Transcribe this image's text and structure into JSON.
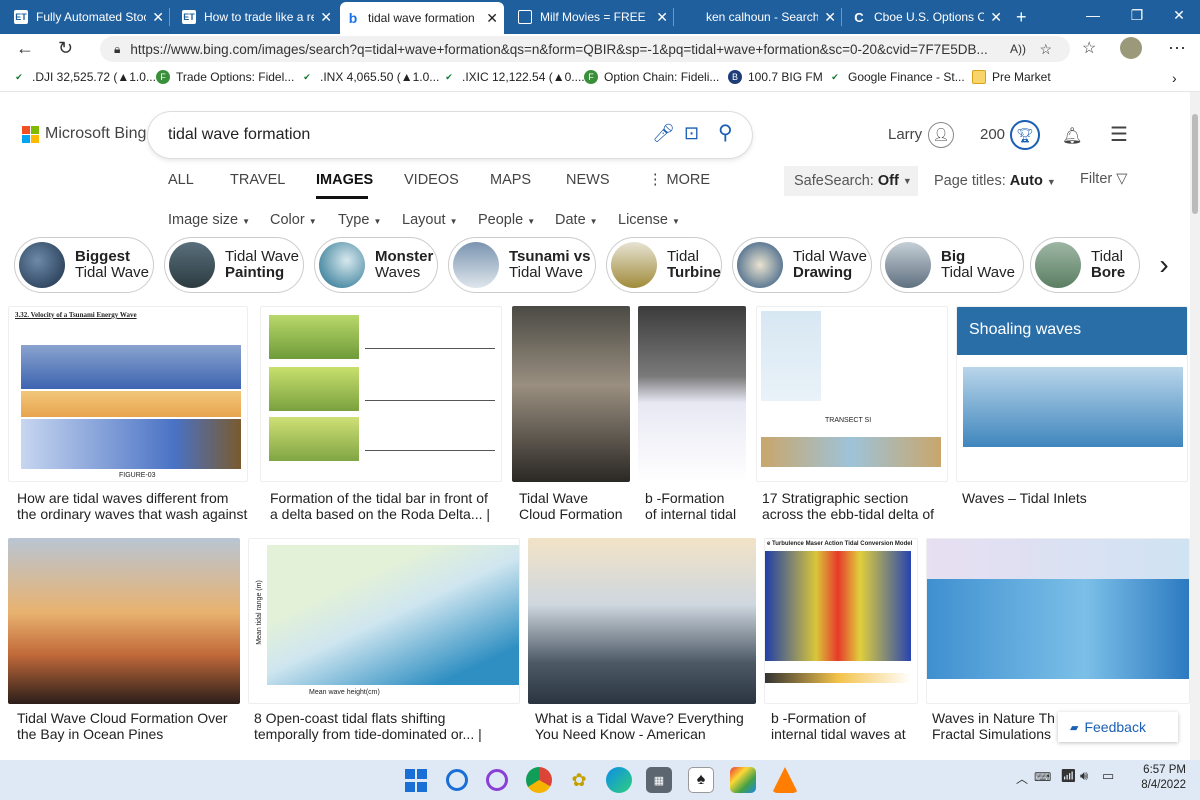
{
  "browser": {
    "tabs": [
      {
        "title": "Fully Automated Stoc",
        "icon": "ET"
      },
      {
        "title": "How to trade like a re",
        "icon": "ET"
      },
      {
        "title": "tidal wave formation",
        "icon": "b"
      },
      {
        "title": "Milf Movies = FREE M",
        "icon": "doc"
      },
      {
        "title": "ken calhoun - Search",
        "icon": ""
      },
      {
        "title": "Cboe U.S. Options Cu",
        "icon": "C"
      }
    ],
    "url": "https://www.bing.com/images/search?q=tidal+wave+formation&qs=n&form=QBIR&sp=-1&pq=tidal+wave+formation&sc=0-20&cvid=7F7E5DB...",
    "favorites": [
      ".DJI 32,525.72 (▲1.0...",
      "Trade Options: Fidel...",
      ".INX 4,065.50 (▲1.0...",
      ".IXIC 12,122.54 (▲0....",
      "Option Chain: Fideli...",
      "100.7 BIG FM",
      "Google Finance - St...",
      "Pre Market"
    ]
  },
  "bing": {
    "logo_text": "Microsoft Bing",
    "query": "tidal wave formation",
    "user": "Larry",
    "points": "200",
    "nav": [
      "ALL",
      "TRAVEL",
      "IMAGES",
      "VIDEOS",
      "MAPS",
      "NEWS",
      "⋮ MORE"
    ],
    "safesearch_label": "SafeSearch:",
    "safesearch_value": "Off",
    "page_titles_label": "Page titles:",
    "page_titles_value": "Auto",
    "filter_label": "Filter",
    "filters": [
      "Image size",
      "Color",
      "Type",
      "Layout",
      "People",
      "Date",
      "License"
    ],
    "pills": [
      {
        "line1": "Biggest",
        "line2": "Tidal Wave",
        "bold": 1
      },
      {
        "line1": "Tidal Wave",
        "line2": "Painting",
        "bold": 2
      },
      {
        "line1": "Monster",
        "line2": "Waves",
        "bold": 1
      },
      {
        "line1": "Tsunami vs",
        "line2": "Tidal Wave",
        "bold": 1
      },
      {
        "line1": "Tidal",
        "line2": "Turbine",
        "bold": 2
      },
      {
        "line1": "Tidal Wave",
        "line2": "Drawing",
        "bold": 2
      },
      {
        "line1": "Big",
        "line2": "Tidal Wave",
        "bold": 1
      },
      {
        "line1": "Tidal",
        "line2": "Bore",
        "bold": 2
      }
    ],
    "row1": [
      {
        "cap1": "How are tidal waves different from",
        "cap2": "the ordinary waves that wash against",
        "img_title": "3.32. Velocity of a Tsunami Energy Wave",
        "img_sub": "FIGURE-03"
      },
      {
        "cap1": "Formation of the tidal bar in front of",
        "cap2": "a delta based on the Roda Delta... |"
      },
      {
        "cap1": "Tidal Wave",
        "cap2": "Cloud Formation"
      },
      {
        "cap1": "b -Formation",
        "cap2": "of internal tidal"
      },
      {
        "cap1": "17 Stratigraphic section",
        "cap2": "across the ebb-tidal delta of",
        "img_title": "TRANSECT SI"
      },
      {
        "cap1": "Waves – Tidal Inlets",
        "cap2": "",
        "img_title": "Shoaling waves"
      }
    ],
    "row2": [
      {
        "cap1": "Tidal Wave Cloud Formation Over",
        "cap2": "the Bay in Ocean Pines"
      },
      {
        "cap1": "8 Open-coast tidal flats shifting",
        "cap2": "temporally from tide-dominated or... |",
        "img_xlabel": "Mean wave height(cm)",
        "img_ylabel": "Mean tidal range (m)"
      },
      {
        "cap1": "What is a Tidal Wave? Everything",
        "cap2": "You Need Know - American"
      },
      {
        "cap1": "b -Formation of",
        "cap2": "internal tidal waves at",
        "img_title": "e Turbulence Maser Action Tidal Conversion Model"
      },
      {
        "cap1": "Waves in Nature Th",
        "cap2": "Fractal Simulations"
      }
    ],
    "feedback": "Feedback"
  },
  "taskbar": {
    "time": "6:57 PM",
    "date": "8/4/2022"
  }
}
